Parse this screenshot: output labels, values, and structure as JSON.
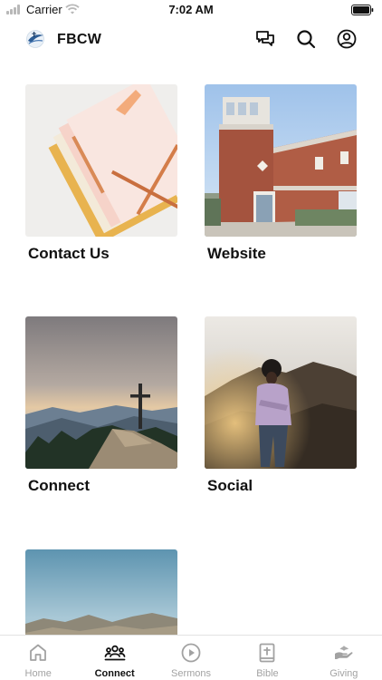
{
  "status_bar": {
    "carrier": "Carrier",
    "time": "7:02 AM"
  },
  "header": {
    "title": "FBCW",
    "icons": [
      "chat-icon",
      "search-icon",
      "profile-icon"
    ]
  },
  "tiles": [
    {
      "label": "Contact Us",
      "image": "envelopes-and-pen-photo"
    },
    {
      "label": "Website",
      "image": "church-building-photo"
    },
    {
      "label": "Connect",
      "image": "cross-on-mountain-photo"
    },
    {
      "label": "Social",
      "image": "person-on-hill-photo"
    },
    {
      "label": "",
      "image": "desert-mountains-photo"
    }
  ],
  "tabs": [
    {
      "label": "Home",
      "icon": "home-icon",
      "active": false
    },
    {
      "label": "Connect",
      "icon": "group-icon",
      "active": true
    },
    {
      "label": "Sermons",
      "icon": "play-icon",
      "active": false
    },
    {
      "label": "Bible",
      "icon": "bible-icon",
      "active": false
    },
    {
      "label": "Giving",
      "icon": "giving-icon",
      "active": false
    }
  ],
  "colors": {
    "active_tab": "#111111",
    "inactive_tab": "#a2a2a2",
    "background": "#ffffff"
  }
}
